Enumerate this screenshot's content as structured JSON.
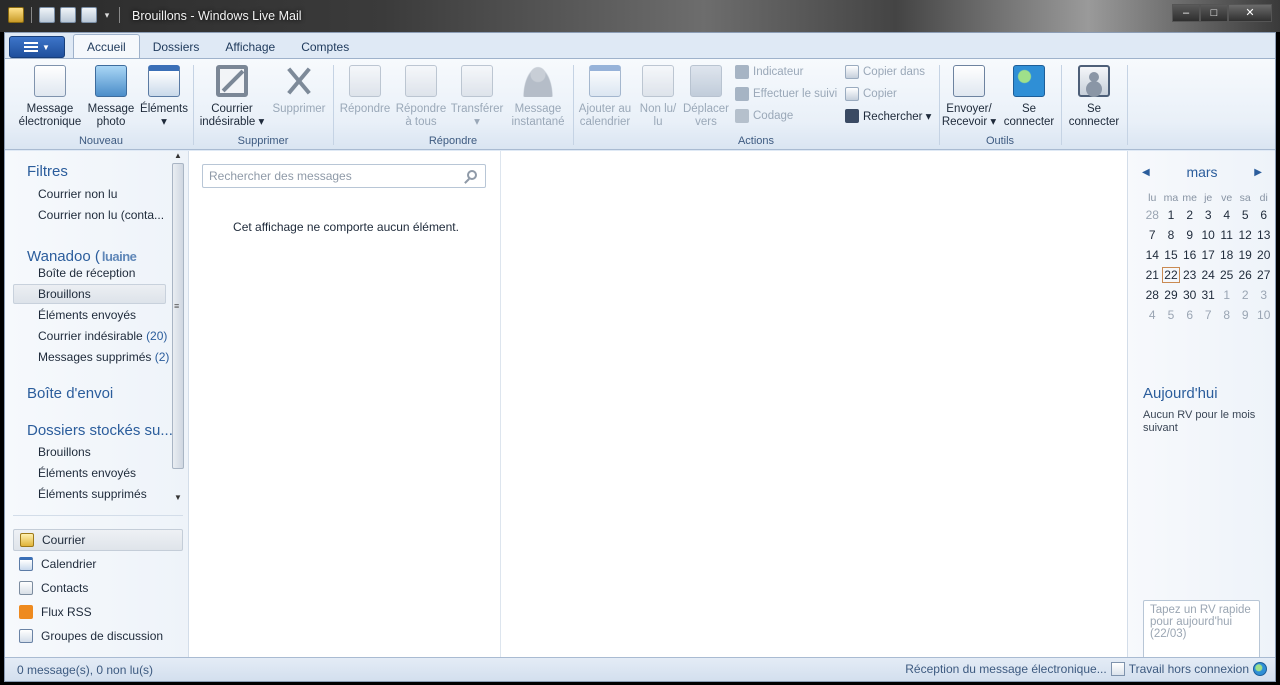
{
  "window": {
    "title": "Brouillons - Windows Live Mail",
    "minimize": "–",
    "maximize": "□",
    "close": "✕"
  },
  "tabs": [
    "Accueil",
    "Dossiers",
    "Affichage",
    "Comptes"
  ],
  "ribbon": {
    "nouveau": {
      "label": "Nouveau",
      "message_electronique": [
        "Message",
        "électronique"
      ],
      "message_photo": [
        "Message",
        "photo"
      ],
      "elements": [
        "Éléments",
        "▾"
      ]
    },
    "supprimer": {
      "label": "Supprimer",
      "courrier_indesirable": [
        "Courrier",
        "indésirable ▾"
      ],
      "supprimer": [
        "Supprimer",
        ""
      ]
    },
    "repondre": {
      "label": "Répondre",
      "repondre": [
        "Répondre",
        ""
      ],
      "repondre_tous": [
        "Répondre",
        "à tous"
      ],
      "transferer": [
        "Transférer",
        "▾"
      ],
      "message_instantane": [
        "Message",
        "instantané"
      ]
    },
    "actions": {
      "label": "Actions",
      "ajouter_calendrier": [
        "Ajouter au",
        "calendrier"
      ],
      "non_lu": [
        "Non lu/",
        "lu"
      ],
      "deplacer": [
        "Déplacer",
        "vers"
      ],
      "indicateur": "Indicateur",
      "effectuer_suivi": "Effectuer le suivi",
      "codage": "Codage",
      "copier_dans": "Copier dans",
      "copier": "Copier",
      "rechercher": "Rechercher ▾"
    },
    "outils": {
      "label": "Outils",
      "envoyer_recevoir": [
        "Envoyer/",
        "Recevoir ▾"
      ],
      "se_connecter": [
        "Se",
        "connecter"
      ]
    },
    "account": {
      "se_connecter": [
        "Se",
        "connecter"
      ]
    }
  },
  "folders": {
    "filtres_title": "Filtres",
    "courrier_non_lu": "Courrier non lu",
    "courrier_non_lu_contacts": "Courrier non lu (conta...",
    "wanadoo_title": "Wanadoo (",
    "wanadoo_smudge": "luaine",
    "boite_reception": "Boîte de réception",
    "brouillons": "Brouillons",
    "elements_envoyes": "Éléments envoyés",
    "courrier_indesirable": "Courrier indésirable",
    "courrier_indesirable_count": "(20)",
    "messages_supprimes": "Messages supprimés",
    "messages_supprimes_count": "(2)",
    "boite_envoi_title": "Boîte d'envoi",
    "dossiers_stockes_title": "Dossiers stockés su...",
    "stored_brouillons": "Brouillons",
    "stored_elements_envoyes": "Éléments envoyés",
    "stored_elements_supprimes": "Éléments supprimés"
  },
  "nav": {
    "courrier": "Courrier",
    "calendrier": "Calendrier",
    "contacts": "Contacts",
    "flux_rss": "Flux RSS",
    "groupes": "Groupes de discussion"
  },
  "message_list": {
    "search_placeholder": "Rechercher des messages",
    "empty_text": "Cet affichage ne comporte aucun élément."
  },
  "calendar": {
    "month": "mars",
    "prev": "◀",
    "next": "▶",
    "weekdays": [
      "lu",
      "ma",
      "me",
      "je",
      "ve",
      "sa",
      "di"
    ],
    "weeks": [
      [
        {
          "d": "28",
          "o": true
        },
        {
          "d": "1"
        },
        {
          "d": "2"
        },
        {
          "d": "3"
        },
        {
          "d": "4"
        },
        {
          "d": "5"
        },
        {
          "d": "6"
        }
      ],
      [
        {
          "d": "7"
        },
        {
          "d": "8"
        },
        {
          "d": "9"
        },
        {
          "d": "10"
        },
        {
          "d": "11"
        },
        {
          "d": "12"
        },
        {
          "d": "13"
        }
      ],
      [
        {
          "d": "14"
        },
        {
          "d": "15"
        },
        {
          "d": "16"
        },
        {
          "d": "17"
        },
        {
          "d": "18"
        },
        {
          "d": "19"
        },
        {
          "d": "20"
        }
      ],
      [
        {
          "d": "21"
        },
        {
          "d": "22",
          "t": true
        },
        {
          "d": "23"
        },
        {
          "d": "24"
        },
        {
          "d": "25"
        },
        {
          "d": "26"
        },
        {
          "d": "27"
        }
      ],
      [
        {
          "d": "28"
        },
        {
          "d": "29"
        },
        {
          "d": "30"
        },
        {
          "d": "31"
        },
        {
          "d": "1",
          "o": true
        },
        {
          "d": "2",
          "o": true
        },
        {
          "d": "3",
          "o": true
        }
      ],
      [
        {
          "d": "4",
          "o": true
        },
        {
          "d": "5",
          "o": true
        },
        {
          "d": "6",
          "o": true
        },
        {
          "d": "7",
          "o": true
        },
        {
          "d": "8",
          "o": true
        },
        {
          "d": "9",
          "o": true
        },
        {
          "d": "10",
          "o": true
        }
      ]
    ],
    "today_title": "Aujourd'hui",
    "today_text": "Aucun RV pour le mois suivant",
    "quick_placeholder": "Tapez un RV rapide pour aujourd'hui (22/03)"
  },
  "status": {
    "left": "0 message(s), 0 non lu(s)",
    "receiving": "Réception du message électronique...",
    "offline": "Travail hors connexion"
  },
  "icons": {
    "app": "windows-live-mail-icon",
    "search": "magnifier-icon"
  }
}
